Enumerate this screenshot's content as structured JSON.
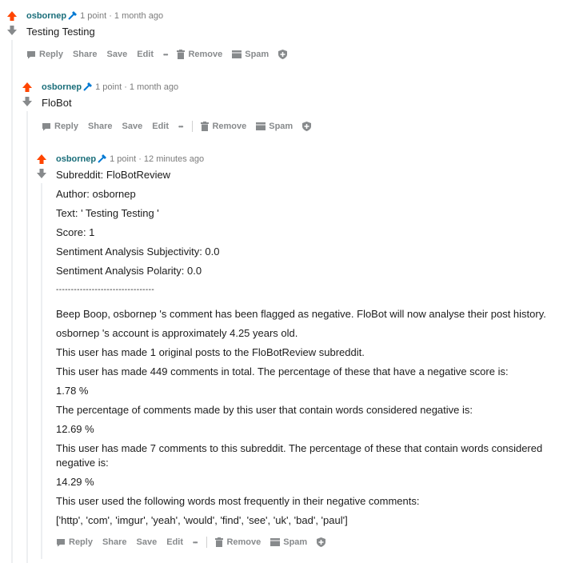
{
  "comments": [
    {
      "author": "osbornep",
      "meta": "1 point · 1 month ago",
      "body": [
        "Testing Testing"
      ]
    },
    {
      "author": "osbornep",
      "meta": "1 point · 1 month ago",
      "body": [
        "FloBot"
      ]
    },
    {
      "author": "osbornep",
      "meta": "1 point · 12 minutes ago",
      "body": [
        "Subreddit: FloBotReview",
        "Author: osbornep",
        "Text: ' Testing Testing '",
        "Score: 1",
        "Sentiment Analysis Subjectivity: 0.0",
        "Sentiment Analysis Polarity: 0.0",
        "---------------------------------",
        "Beep Boop, osbornep 's comment has been flagged as negative. FloBot will now analyse their post history.",
        "osbornep 's account is approximately 4.25 years old.",
        "This user has made 1 original posts to the FloBotReview subreddit.",
        "This user has made 449 comments in total. The percentage of these that have a negative score is:",
        "1.78 %",
        "The percentage of comments made by this user that contain words considered negative is:",
        "12.69 %",
        "This user has made 7 comments to this subreddit. The percentage of these that contain words considered negative is:",
        "14.29 %",
        "This user used the following words most frequently in their negative comments:",
        "['http', 'com', 'imgur', 'yeah', 'would', 'find', 'see', 'uk', 'bad', 'paul']"
      ]
    }
  ],
  "actions": {
    "reply": "Reply",
    "share": "Share",
    "save": "Save",
    "edit": "Edit",
    "more": "•••",
    "remove": "Remove",
    "spam": "Spam"
  },
  "colors": {
    "upvote": "#ff4500",
    "downvote": "#878a8c",
    "accent": "#0079d3"
  }
}
